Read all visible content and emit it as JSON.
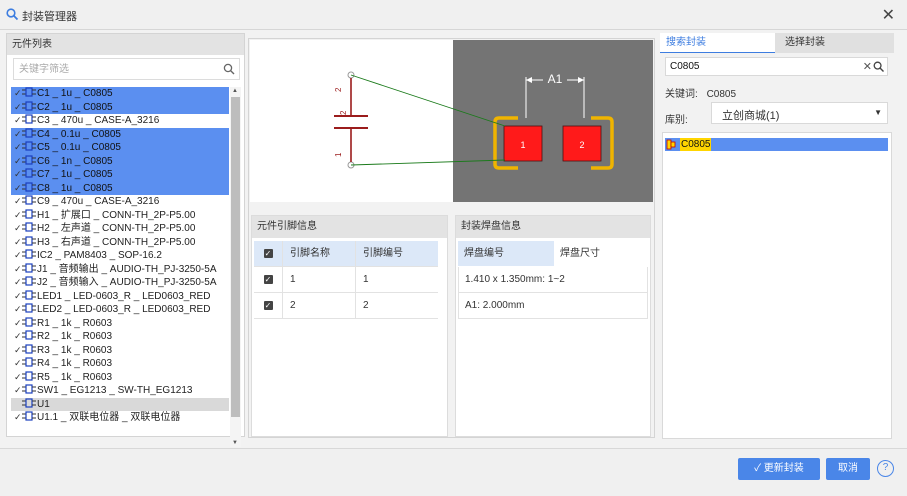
{
  "dialog": {
    "title": "封装管理器",
    "close_glyph": "✕"
  },
  "left": {
    "header": "元件列表",
    "filter_placeholder": "关键字筛选",
    "items": [
      {
        "label": "C1 _ 1u _ C0805",
        "selected": true,
        "checked": true
      },
      {
        "label": "C2 _ 1u _ C0805",
        "selected": true,
        "checked": true
      },
      {
        "label": "C3 _ 470u _ CASE-A_3216",
        "selected": false,
        "checked": true
      },
      {
        "label": "C4 _ 0.1u _ C0805",
        "selected": true,
        "checked": true
      },
      {
        "label": "C5 _ 0.1u _ C0805",
        "selected": true,
        "checked": true
      },
      {
        "label": "C6 _ 1n _ C0805",
        "selected": true,
        "checked": true
      },
      {
        "label": "C7 _ 1u _ C0805",
        "selected": true,
        "checked": true
      },
      {
        "label": "C8 _ 1u _ C0805",
        "selected": true,
        "checked": true
      },
      {
        "label": "C9 _ 470u _ CASE-A_3216",
        "selected": false,
        "checked": true
      },
      {
        "label": "H1 _ 扩展口 _ CONN-TH_2P-P5.00",
        "selected": false,
        "checked": true
      },
      {
        "label": "H2 _ 左声道 _ CONN-TH_2P-P5.00",
        "selected": false,
        "checked": true
      },
      {
        "label": "H3 _ 右声道 _ CONN-TH_2P-P5.00",
        "selected": false,
        "checked": true
      },
      {
        "label": "IC2 _ PAM8403 _ SOP-16.2",
        "selected": false,
        "checked": true
      },
      {
        "label": "J1 _ 音频输出 _ AUDIO-TH_PJ-3250-5A",
        "selected": false,
        "checked": true
      },
      {
        "label": "J2 _ 音频输入 _ AUDIO-TH_PJ-3250-5A",
        "selected": false,
        "checked": true
      },
      {
        "label": "LED1 _ LED-0603_R _ LED0603_RED",
        "selected": false,
        "checked": true
      },
      {
        "label": "LED2 _ LED-0603_R _ LED0603_RED",
        "selected": false,
        "checked": true
      },
      {
        "label": "R1 _ 1k _ R0603",
        "selected": false,
        "checked": true
      },
      {
        "label": "R2 _ 1k _ R0603",
        "selected": false,
        "checked": true
      },
      {
        "label": "R3 _ 1k _ R0603",
        "selected": false,
        "checked": true
      },
      {
        "label": "R4 _ 1k _ R0603",
        "selected": false,
        "checked": true
      },
      {
        "label": "R5 _ 1k _ R0603",
        "selected": false,
        "checked": true
      },
      {
        "label": "SW1 _ EG1213 _ SW-TH_EG1213",
        "selected": false,
        "checked": true
      },
      {
        "label": "U1",
        "selected": false,
        "checked": false,
        "current": true
      },
      {
        "label": "U1.1 _ 双联电位器 _ 双联电位器",
        "selected": false,
        "checked": true
      }
    ]
  },
  "preview": {
    "pin_labels": [
      "2",
      "1"
    ],
    "pad_labels": [
      "1",
      "2"
    ],
    "dimension_label": "A1"
  },
  "pin_info": {
    "header": "元件引脚信息",
    "col_name": "引脚名称",
    "col_number": "引脚编号",
    "rows": [
      {
        "name": "1",
        "number": "1"
      },
      {
        "name": "2",
        "number": "2"
      }
    ]
  },
  "pad_info": {
    "header": "封装焊盘信息",
    "tab_pad_number": "焊盘编号",
    "tab_pad_size": "焊盘尺寸",
    "rows": [
      "1.410 x 1.350mm: 1~2",
      "A1: 2.000mm"
    ]
  },
  "right": {
    "tab_search": "搜索封装",
    "tab_select": "选择封装",
    "search_value": "C0805",
    "keyword_label": "关键词:",
    "keyword_value": "C0805",
    "library_label": "库别:",
    "library_value": "立创商城(1)",
    "results": [
      "C0805"
    ]
  },
  "footer": {
    "update_label": "更新封装",
    "cancel_label": "取消",
    "help_glyph": "?"
  },
  "colors": {
    "selection": "#5b8ff0",
    "accent": "#4a86e8",
    "pad_fill": "#ff1a1a",
    "pad_ring": "#f0b400",
    "pcb_bg": "#747474",
    "highlight": "#ffd500"
  }
}
